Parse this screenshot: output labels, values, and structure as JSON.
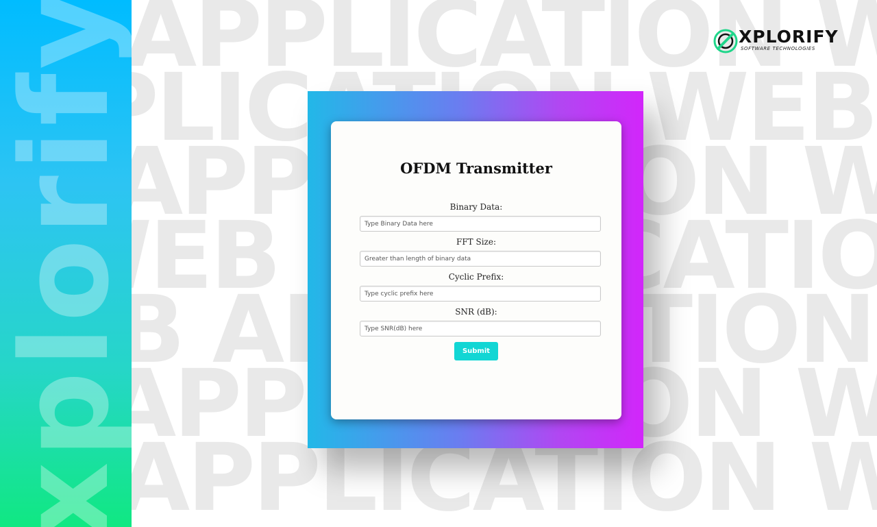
{
  "brand": {
    "side_text": "xplorify",
    "logo_name": "XPLORIFY",
    "logo_tagline": "SOFTWARE TECHNOLOGIES",
    "logo_icon": "xplorify-logo-icon",
    "colors": {
      "side_top": "#00bcff",
      "side_bottom": "#10e882",
      "logo_accent": "#1fd68a"
    }
  },
  "watermark": {
    "rows": [
      "APPLICATION WEB APPLICATION",
      "PLICATION WEB APPLICATION",
      "APPLICATION WEB APPLICATION",
      "WEB APPLICATION WEB APPLICATION",
      "WEB APPLICATION WEB APPLICATION",
      "APPLICATION WEB APPLICATION",
      "APPLICATION WEB APPLICATION"
    ],
    "color": "#e9e9e9"
  },
  "form": {
    "title": "OFDM Transmitter",
    "fields": [
      {
        "label": "Binary Data:",
        "placeholder": "Type Binary Data here",
        "value": ""
      },
      {
        "label": "FFT Size:",
        "placeholder": "Greater than length of binary data",
        "value": ""
      },
      {
        "label": "Cyclic Prefix:",
        "placeholder": "Type cyclic prefix here",
        "value": ""
      },
      {
        "label": "SNR (dB):",
        "placeholder": "Type SNR(dB) here",
        "value": ""
      }
    ],
    "submit_label": "Submit",
    "colors": {
      "frame_start": "#22b8e8",
      "frame_end": "#d226fa",
      "submit": "#12d6d4"
    }
  }
}
